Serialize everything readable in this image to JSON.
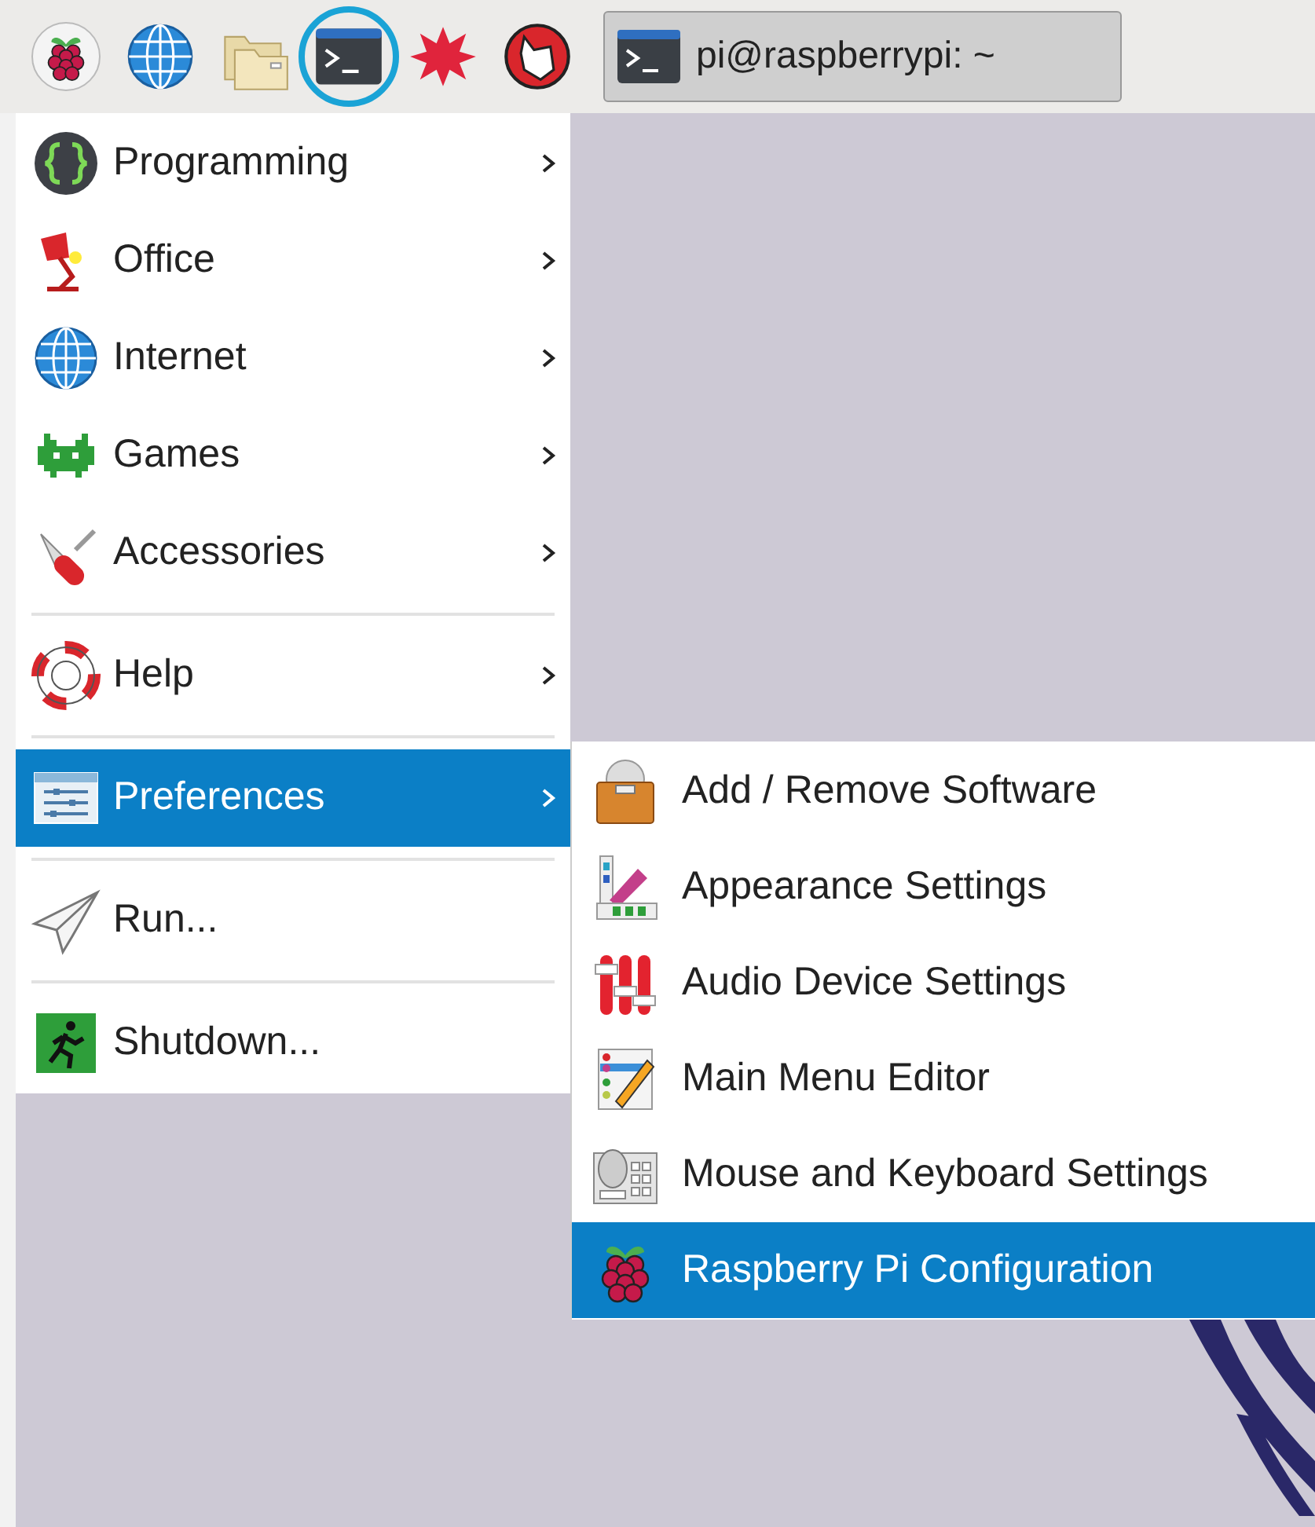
{
  "taskbar": {
    "launchers": [
      {
        "highlighted": false
      },
      {
        "highlighted": false
      },
      {
        "highlighted": false
      },
      {
        "highlighted": true
      },
      {
        "highlighted": false
      },
      {
        "highlighted": false
      }
    ],
    "task_button": {
      "label": "pi@raspberrypi: ~"
    }
  },
  "main_menu": {
    "items": [
      {
        "kind": "item",
        "label": "Programming",
        "submenu": true,
        "selected": false
      },
      {
        "kind": "item",
        "label": "Office",
        "submenu": true,
        "selected": false
      },
      {
        "kind": "item",
        "label": "Internet",
        "submenu": true,
        "selected": false
      },
      {
        "kind": "item",
        "label": "Games",
        "submenu": true,
        "selected": false
      },
      {
        "kind": "item",
        "label": "Accessories",
        "submenu": true,
        "selected": false
      },
      {
        "kind": "separator"
      },
      {
        "kind": "item",
        "label": "Help",
        "submenu": true,
        "selected": false
      },
      {
        "kind": "separator"
      },
      {
        "kind": "item",
        "label": "Preferences",
        "submenu": true,
        "selected": true
      },
      {
        "kind": "separator"
      },
      {
        "kind": "item",
        "label": "Run...",
        "submenu": false,
        "selected": false
      },
      {
        "kind": "separator"
      },
      {
        "kind": "item",
        "label": "Shutdown...",
        "submenu": false,
        "selected": false
      }
    ]
  },
  "submenu": {
    "items": [
      {
        "label": "Add / Remove Software",
        "selected": false
      },
      {
        "label": "Appearance Settings",
        "selected": false
      },
      {
        "label": "Audio Device Settings",
        "selected": false
      },
      {
        "label": "Main Menu Editor",
        "selected": false
      },
      {
        "label": "Mouse and Keyboard Settings",
        "selected": false
      },
      {
        "label": "Raspberry Pi Configuration",
        "selected": true
      }
    ]
  }
}
